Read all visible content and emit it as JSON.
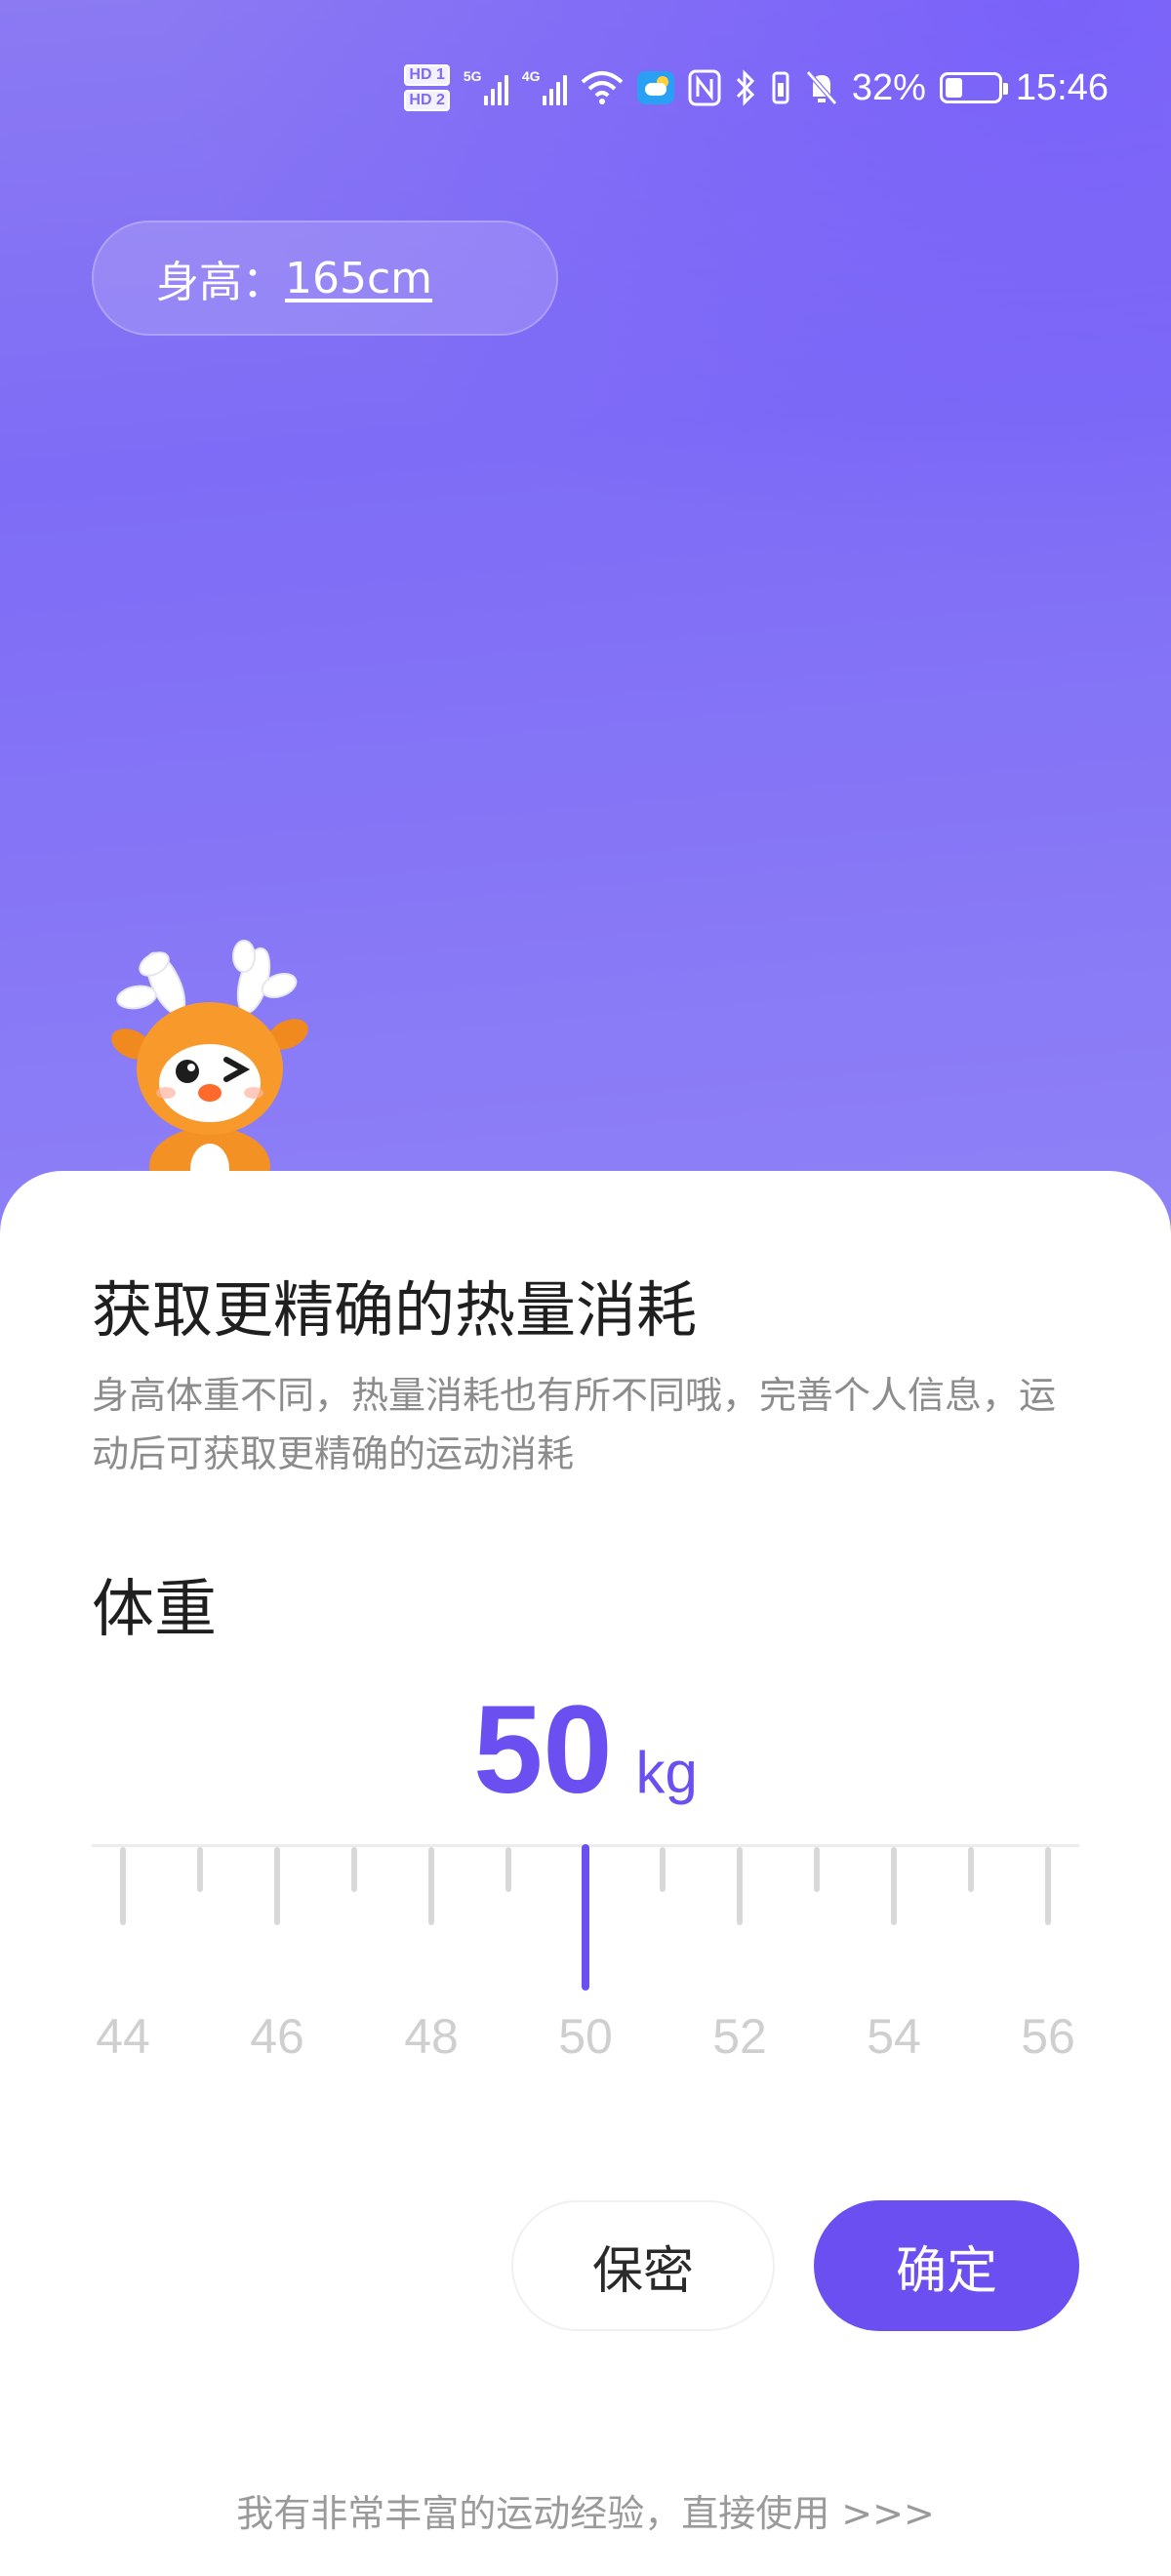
{
  "status_bar": {
    "hd1": "HD 1",
    "hd2": "HD 2",
    "net1": "5G",
    "net2": "4G",
    "battery_percent": "32%",
    "battery_level": 0.32,
    "time": "15:46",
    "icons": [
      "hd-icon",
      "signal-5g-icon",
      "signal-4g-icon",
      "wifi-icon",
      "weather-app-icon",
      "nfc-icon",
      "bluetooth-icon",
      "vibrate-icon",
      "mute-bell-icon",
      "battery-icon"
    ]
  },
  "height": {
    "label": "身高：",
    "value": "165cm"
  },
  "sheet": {
    "title": "获取更精确的热量消耗",
    "description": "身高体重不同，热量消耗也有所不同哦，完善个人信息，运动后可获取更精确的运动消耗",
    "weight_label": "体重",
    "value": "50",
    "unit": "kg",
    "ruler_labels": [
      "44",
      "46",
      "48",
      "50",
      "52",
      "54",
      "56"
    ],
    "ruler_min": 44,
    "ruler_max": 56,
    "selected": 50,
    "accent": "#6b4ff0"
  },
  "buttons": {
    "secret": "保密",
    "confirm": "确定"
  },
  "skip_link": "我有非常丰富的运动经验，直接使用 >>>"
}
